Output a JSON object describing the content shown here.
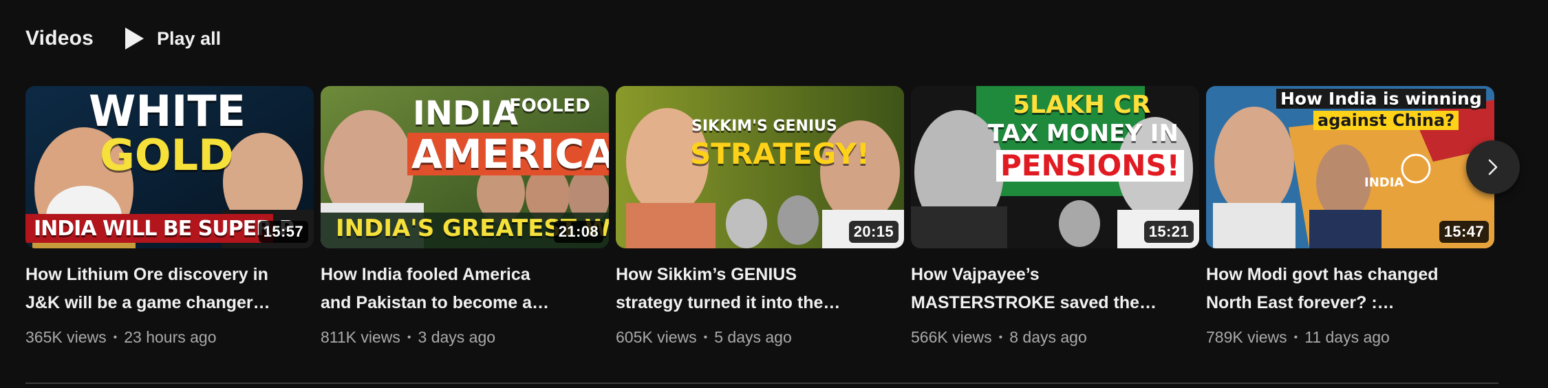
{
  "shelf": {
    "title": "Videos",
    "play_all_label": "Play all",
    "play_icon": "play-icon",
    "next_icon": "chevron-right-icon"
  },
  "videos": [
    {
      "thumb_text": [
        "WHITE",
        "GOLD",
        "INDIA WILL BE SUPER-P"
      ],
      "duration": "15:57",
      "title_line1": "How Lithium Ore discovery in",
      "title_line2": "J&K will be a game changer…",
      "views": "365K views",
      "age": "23 hours ago",
      "accent": "#f6e03a"
    },
    {
      "thumb_text": [
        "INDIA",
        "FOOLED",
        "AMERICA?",
        "INDIA'S GREATEST WIN"
      ],
      "duration": "21:08",
      "title_line1": "How India fooled America",
      "title_line2": "and Pakistan to become a…",
      "views": "811K views",
      "age": "3 days ago",
      "accent": "#e2502b"
    },
    {
      "thumb_text": [
        "SIKKIM'S GENIUS",
        "STRATEGY!"
      ],
      "duration": "20:15",
      "title_line1": "How Sikkim’s GENIUS",
      "title_line2": "strategy turned it into the…",
      "views": "605K views",
      "age": "5 days ago",
      "accent": "#ffd21a"
    },
    {
      "thumb_text": [
        "5LAKH CR",
        "TAX MONEY IN",
        "PENSIONS!"
      ],
      "duration": "15:21",
      "title_line1": "How Vajpayee’s",
      "title_line2": "MASTERSTROKE saved the…",
      "views": "566K views",
      "age": "8 days ago",
      "accent": "#e11b22"
    },
    {
      "thumb_text": [
        "How India is winning",
        "against China?",
        "INDIA"
      ],
      "duration": "15:47",
      "title_line1": "How Modi govt has changed",
      "title_line2": "North East forever? :…",
      "views": "789K views",
      "age": "11 days ago",
      "accent": "#ffd21a"
    }
  ]
}
